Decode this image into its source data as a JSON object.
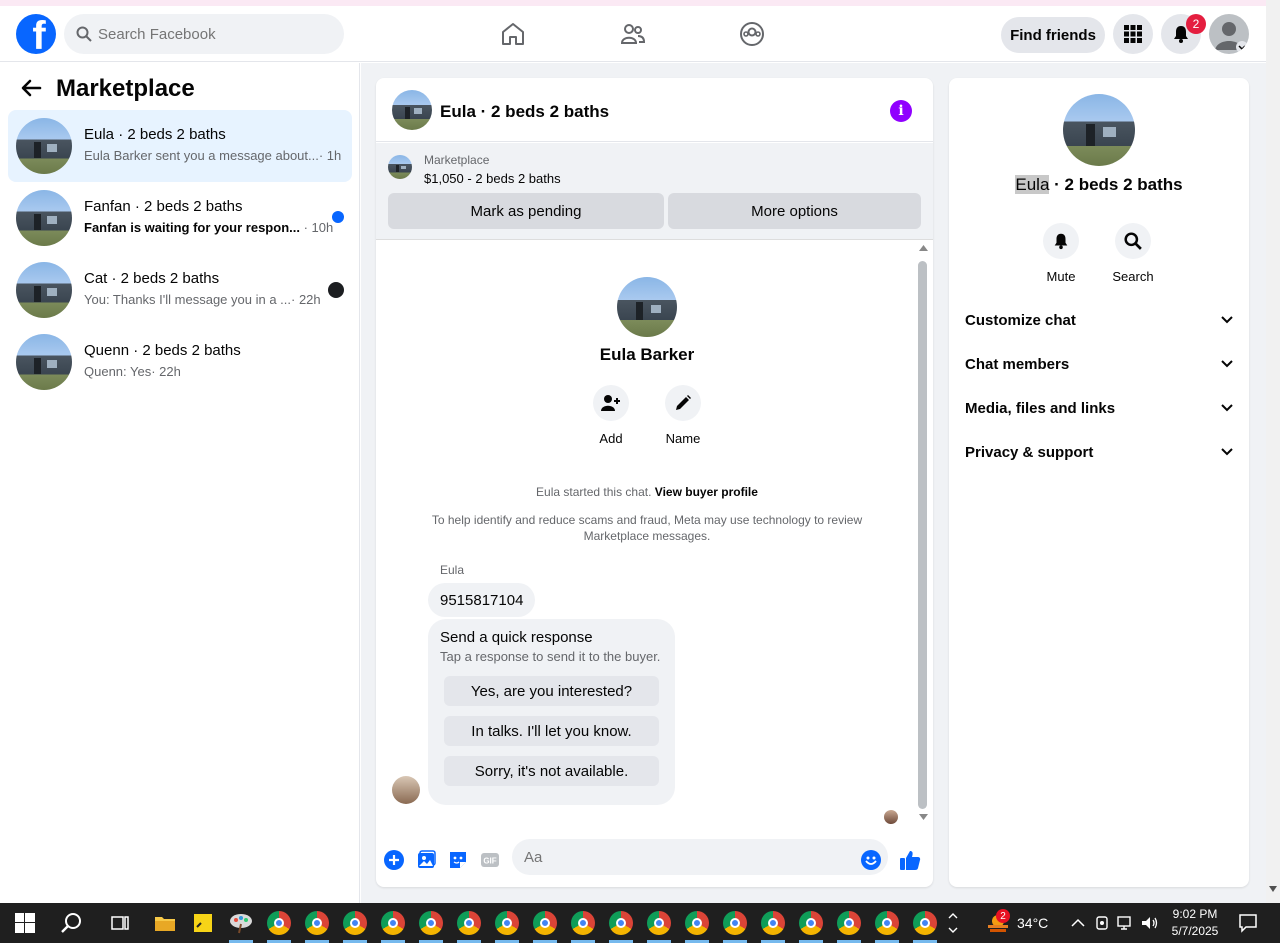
{
  "colors": {
    "brand": "#0866ff",
    "badge": "#e41e3f",
    "info": "#9000ff",
    "active_row": "#e7f3ff"
  },
  "nav": {
    "search_placeholder": "Search Facebook",
    "find_friends": "Find friends",
    "notif_count": "2"
  },
  "sidebar": {
    "title": "Marketplace",
    "conversations": [
      {
        "name": "Eula · 2 beds 2 baths",
        "preview": "Eula Barker sent you a message about...",
        "time": "· 1h"
      },
      {
        "name": "Fanfan · 2 beds 2 baths",
        "preview": "Fanfan is waiting for your respon...",
        "time": "· 10h"
      },
      {
        "name": "Cat · 2 beds 2 baths",
        "preview": "You: Thanks I'll message you in a ...",
        "time": "· 22h"
      },
      {
        "name": "Quenn · 2 beds 2 baths",
        "preview": "Quenn: Yes",
        "time": "· 22h"
      }
    ]
  },
  "chat": {
    "title": "Eula · 2 beds 2 baths",
    "marketplace_label": "Marketplace",
    "price_line": "$1,050 - 2 beds 2 baths",
    "mark_pending": "Mark as pending",
    "more_options": "More options",
    "profile_name": "Eula Barker",
    "add_label": "Add",
    "name_label": "Name",
    "started_text": "Eula started this chat.",
    "view_profile": "View buyer profile",
    "notice": "To help identify and reduce scams and fraud, Meta may use technology to review Marketplace messages.",
    "sender": "Eula",
    "message": "9515817104",
    "quick_title": "Send a quick response",
    "quick_sub": "Tap a response to send it to the buyer.",
    "quick_options": [
      "Yes, are you interested?",
      "In talks. I'll let you know.",
      "Sorry, it's not available."
    ],
    "composer_placeholder": "Aa"
  },
  "details": {
    "title_highlight": "Eula",
    "title_rest": " · 2 beds 2 baths",
    "mute": "Mute",
    "search": "Search",
    "sections": [
      "Customize chat",
      "Chat members",
      "Media, files and links",
      "Privacy & support"
    ]
  },
  "taskbar": {
    "weather_badge": "2",
    "temperature": "34°C",
    "time": "9:02 PM",
    "date": "5/7/2025"
  }
}
